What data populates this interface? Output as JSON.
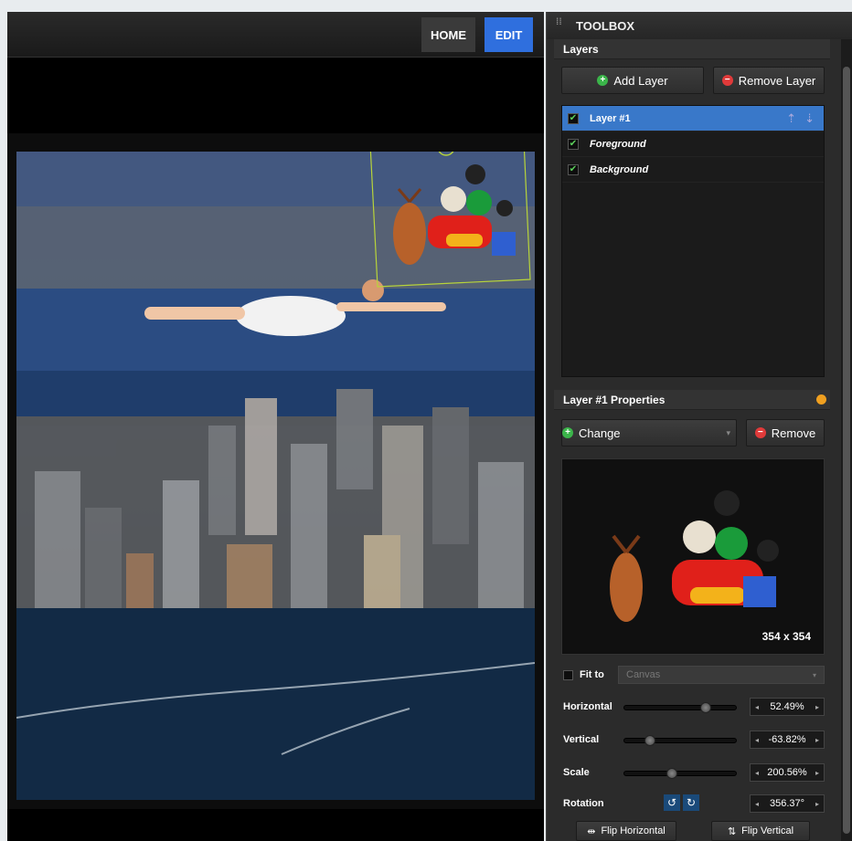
{
  "nav": {
    "home_label": "HOME",
    "edit_label": "EDIT"
  },
  "toolbox": {
    "title": "TOOLBOX",
    "layers_title": "Layers",
    "add_layer_label": "Add Layer",
    "remove_layer_label": "Remove Layer",
    "layers": [
      {
        "name": "Layer #1",
        "checked": true,
        "selected": true
      },
      {
        "name": "Foreground",
        "checked": true,
        "selected": false
      },
      {
        "name": "Background",
        "checked": true,
        "selected": false
      }
    ],
    "properties_title": "Layer #1 Properties",
    "change_label": "Change",
    "remove_label": "Remove",
    "preview_size": "354 x 354",
    "fit_to_label": "Fit to",
    "fit_to_value": "Canvas",
    "horizontal_label": "Horizontal",
    "horizontal_value": "52.49%",
    "vertical_label": "Vertical",
    "vertical_value": "-63.82%",
    "scale_label": "Scale",
    "scale_value": "200.56%",
    "rotation_label": "Rotation",
    "rotation_value": "356.37°",
    "flip_horizontal_label": "Flip Horizontal",
    "flip_vertical_label": "Flip Vertical"
  },
  "sliders": {
    "horizontal": 0.75,
    "vertical": 0.2,
    "scale": 0.42
  },
  "colors": {
    "accent": "#2f6fde",
    "selected_row": "#3978c9",
    "selection_box": "#b8d43a"
  }
}
